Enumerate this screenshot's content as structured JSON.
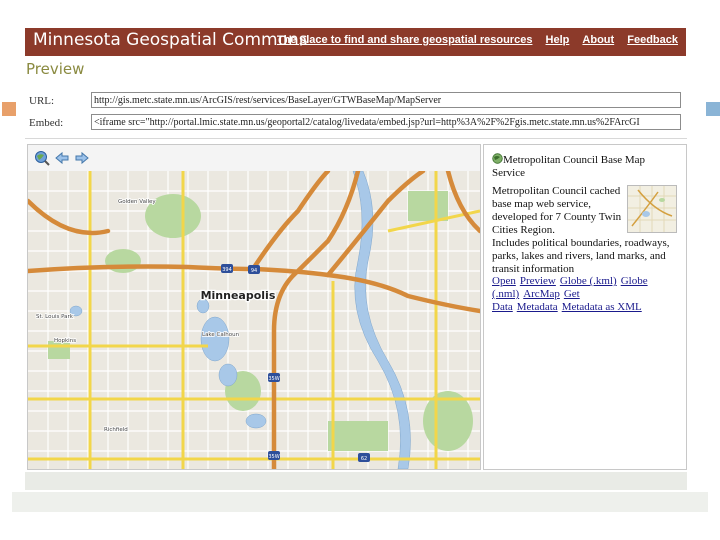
{
  "header": {
    "title": "Minnesota Geospatial Commons",
    "tagline": "The place to find and share geospatial resources",
    "links": [
      "Help",
      "About",
      "Feedback"
    ]
  },
  "preview": {
    "heading": "Preview",
    "url_label": "URL:",
    "url_value": "http://gis.metc.state.mn.us/ArcGIS/rest/services/BaseLayer/GTWBaseMap/MapServer",
    "embed_label": "Embed:",
    "embed_value": "<iframe src=\"http://portal.lmic.state.mn.us/geoportal2/catalog/livedata/embed.jsp?url=http%3A%2F%2Fgis.metc.state.mn.us%2FArcGI"
  },
  "map": {
    "city_label": "Minneapolis",
    "place_labels": [
      "Golden Valley",
      "Lake Calhoun",
      "St. Louis Park",
      "Hopkins",
      "Richfield"
    ],
    "highway_shields": [
      "394",
      "94",
      "35W",
      "35W",
      "62"
    ]
  },
  "info": {
    "title": "Metropolitan Council Base Map Service",
    "desc_part1": "Metropolitan Council cached base map web service, developed for 7 County Twin Cities Region.",
    "desc_part2": "Includes political boundaries, roadways, parks, lakes and rivers, land marks, and transit information",
    "links": [
      "Open",
      "Preview",
      "Globe (.kml)",
      "Globe (.nml)",
      "ArcMap",
      "Get Data",
      "Metadata",
      "Metadata as XML"
    ]
  },
  "colors": {
    "banner": "#8c3a2a",
    "heading": "#8a8a40",
    "highway": "#d58a3a",
    "major_road": "#f2d64a",
    "water": "#a8c8e8",
    "park": "#b8d8a0",
    "slide_marker": "#e8a06a",
    "slide_marker_right": "#8ab4d6"
  }
}
